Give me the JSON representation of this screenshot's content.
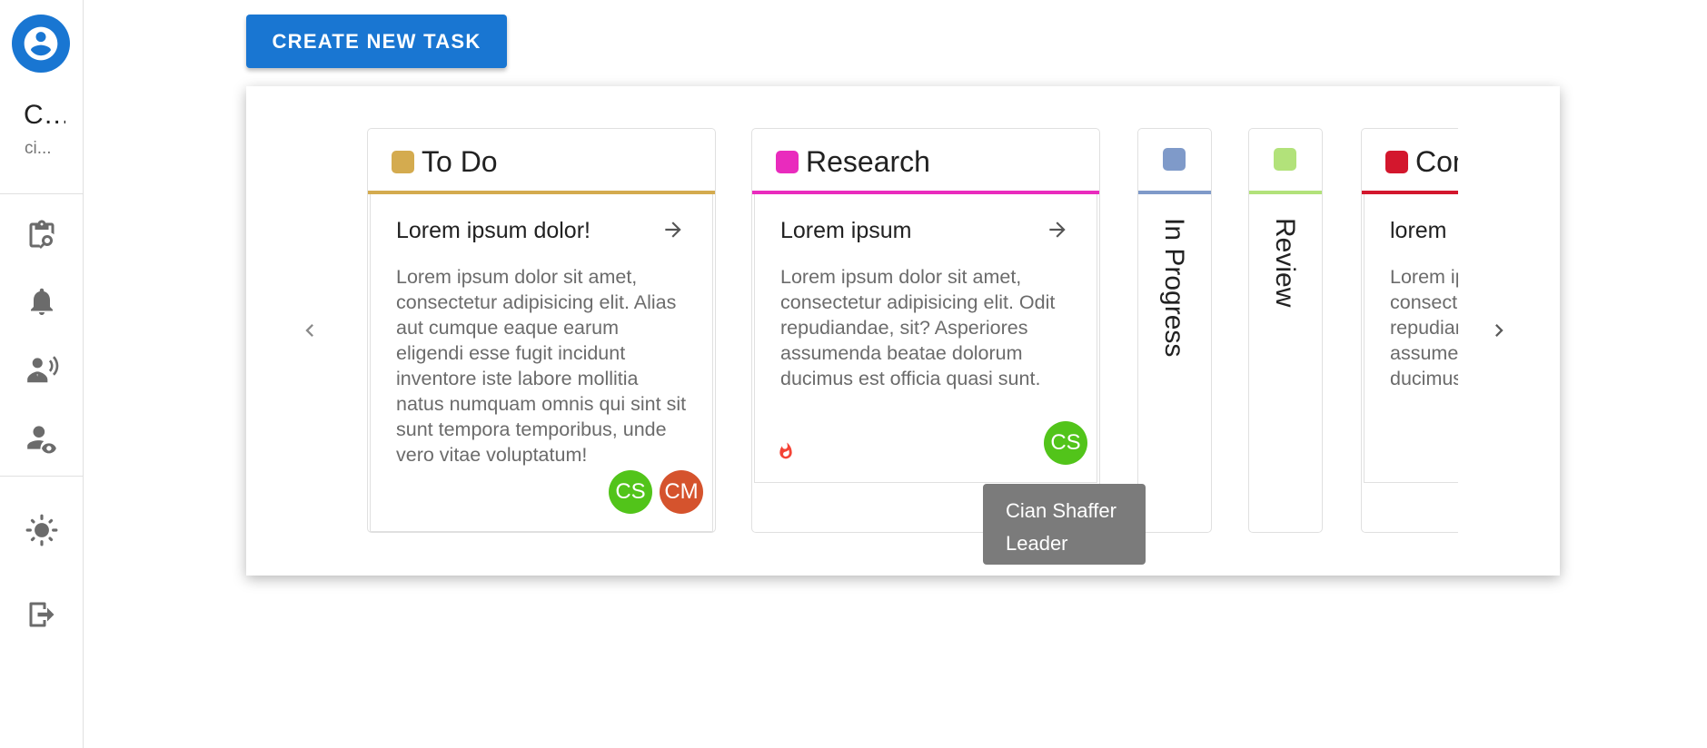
{
  "user": {
    "name": "C...",
    "sub": "ci..."
  },
  "sidebar": {
    "nav": [
      {
        "icon": "clipboard-search-icon"
      },
      {
        "icon": "bell-icon"
      },
      {
        "icon": "presenter-icon"
      },
      {
        "icon": "account-eye-icon"
      }
    ],
    "theme_icon": "sun-icon",
    "logout_icon": "logout-icon"
  },
  "toolbar": {
    "create_label": "CREATE NEW TASK"
  },
  "columns": [
    {
      "title": "To Do",
      "color": "#d4ab4f",
      "tasks": [
        {
          "title": "Lorem ipsum dolor!",
          "desc": "Lorem ipsum dolor sit amet, consectetur adipisicing elit. Alias aut cumque eaque earum eligendi esse fugit incidunt inventore iste labore mollitia natus numquam omnis qui sint sit sunt tempora temporibus, unde vero vitae voluptatum!",
          "assignees": [
            {
              "initials": "CS",
              "color": "#52c41a"
            },
            {
              "initials": "CM",
              "color": "#d5532d"
            }
          ]
        }
      ]
    },
    {
      "title": "Research",
      "color": "#e92bbd",
      "tasks": [
        {
          "title": "Lorem ipsum",
          "desc": "Lorem ipsum dolor sit amet, consectetur adipisicing elit. Odit repudiandae, sit? Asperiores assumenda beatae dolorum ducimus est officia quasi sunt.",
          "priority_icon": "fire-icon",
          "assignees": [
            {
              "initials": "CS",
              "color": "#52c41a"
            }
          ]
        }
      ]
    },
    {
      "title": "In Progress",
      "color": "#7f9ac9",
      "collapsed": true
    },
    {
      "title": "Review",
      "color": "#b2e27a",
      "collapsed": true
    },
    {
      "title": "Completed",
      "color": "#d3172d",
      "tasks": [
        {
          "title": "lorem",
          "desc": "Lorem ipsum dolor sit amet, consectetur adipisicing elit. Odit repudiandae, sit? Asperiores assumenda beatae dolorum ducimus est officia quasi sunt."
        }
      ]
    }
  ],
  "tooltip": {
    "name": "Cian Shaffer",
    "role": "Leader"
  }
}
